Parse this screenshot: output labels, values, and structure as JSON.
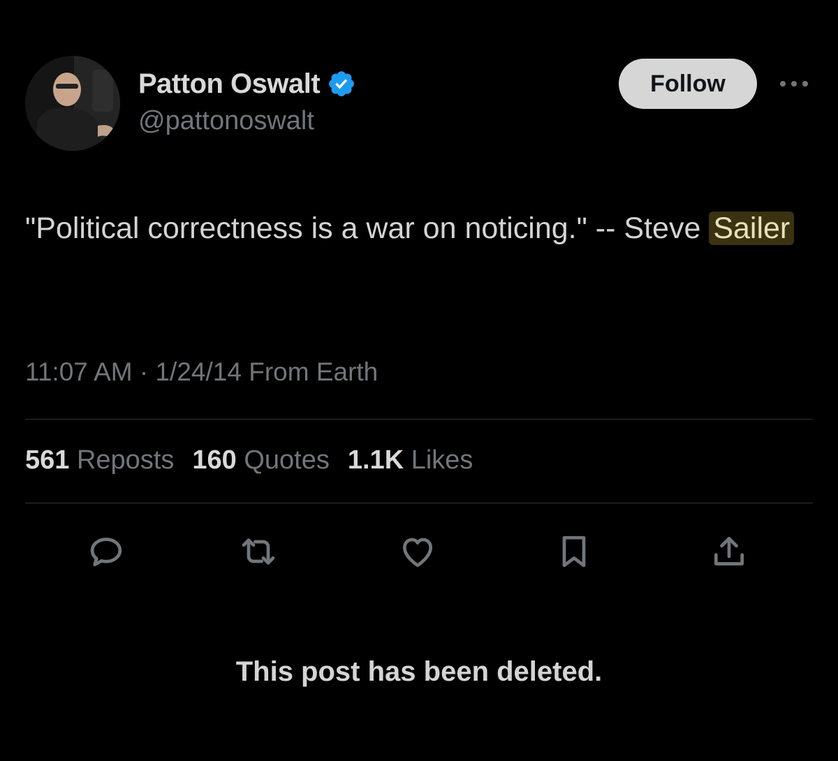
{
  "author": {
    "display_name": "Patton Oswalt",
    "handle": "@pattonoswalt",
    "verified_icon": "verified-badge-icon",
    "verified_color": "#1d9bf0"
  },
  "header": {
    "follow_label": "Follow",
    "more_icon": "more-icon"
  },
  "tweet": {
    "text_before": "\"Political correctness is a war on noticing.\" -- Steve",
    "text_highlight": "Sailer",
    "highlight_color": "#3a3210"
  },
  "meta": {
    "time": "11:07 AM",
    "separator": "·",
    "date": "1/24/14",
    "source": "From Earth"
  },
  "stats": [
    {
      "count": "561",
      "label": "Reposts"
    },
    {
      "count": "160",
      "label": "Quotes"
    },
    {
      "count": "1.1K",
      "label": "Likes"
    }
  ],
  "actions": [
    {
      "icon": "reply-icon"
    },
    {
      "icon": "repost-icon"
    },
    {
      "icon": "like-icon"
    },
    {
      "icon": "bookmark-icon"
    },
    {
      "icon": "share-icon"
    }
  ],
  "notice": "This post has been deleted.",
  "colors": {
    "background": "#000000",
    "text_primary": "#d9d9d9",
    "text_secondary": "#71767b",
    "divider": "#2f3336",
    "follow_bg": "#d6d6d6"
  }
}
